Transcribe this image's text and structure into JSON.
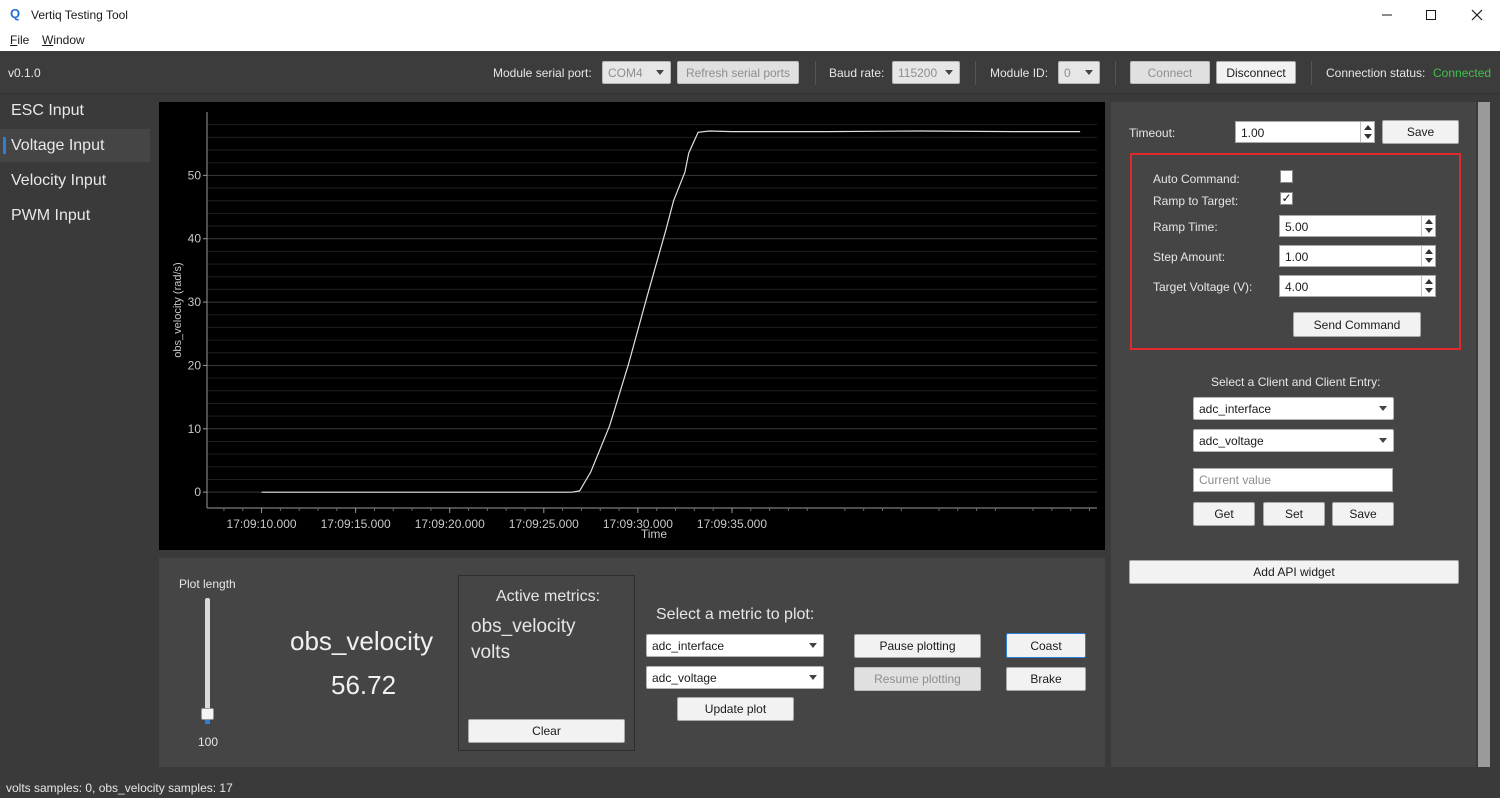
{
  "window": {
    "title": "Vertiq Testing Tool",
    "logo_letter": "Q",
    "menu": [
      "File",
      "Window"
    ],
    "menu_mnemonic_first": [
      "F",
      "W"
    ],
    "menu_rest": [
      "ile",
      "indow"
    ]
  },
  "toolbar": {
    "version": "v0.1.0",
    "serial_port_label": "Module serial port:",
    "serial_port_value": "COM4",
    "refresh_label": "Refresh serial ports",
    "baud_label": "Baud rate:",
    "baud_value": "115200",
    "module_id_label": "Module ID:",
    "module_id_value": "0",
    "connect_label": "Connect",
    "disconnect_label": "Disconnect",
    "conn_status_label": "Connection status:",
    "conn_status_value": "Connected",
    "conn_status_color": "#3fc24a"
  },
  "sidebar": {
    "items": [
      {
        "label": "ESC Input",
        "active": false
      },
      {
        "label": "Voltage Input",
        "active": true
      },
      {
        "label": "Velocity Input",
        "active": false
      },
      {
        "label": "PWM Input",
        "active": false
      }
    ]
  },
  "chart_data": {
    "type": "line",
    "xlabel": "Time",
    "ylabel": "obs_velocity (rad/s)",
    "x_ticks": [
      "17:09:10.000",
      "17:09:15.000",
      "17:09:20.000",
      "17:09:25.000",
      "17:09:30.000",
      "17:09:35.000"
    ],
    "y_ticks": [
      0,
      10,
      20,
      30,
      40,
      50
    ],
    "ylim": [
      -2.5,
      60
    ],
    "xlim_seconds": [
      -2.9,
      44.4
    ],
    "grid": true,
    "series": [
      {
        "x_seconds": [
          0,
          16.5,
          16.9,
          17.5,
          18.5,
          19.5,
          20.5,
          21.5,
          21.9,
          22.5,
          22.7,
          23.2,
          23.8,
          25,
          30,
          35,
          40,
          43.5
        ],
        "values": [
          0.0,
          0.0,
          0.2,
          3.2,
          10.5,
          20.2,
          31.0,
          41.5,
          46.0,
          50.5,
          53.5,
          56.8,
          57.0,
          56.9,
          56.9,
          57.0,
          56.9,
          56.9
        ],
        "color": "#e0e0e0"
      }
    ]
  },
  "plot_controls": {
    "plot_length_label": "Plot length",
    "plot_length_value": "100",
    "metric_name": "obs_velocity",
    "metric_value": "56.72",
    "active_metrics_title": "Active metrics:",
    "active_metrics": [
      "obs_velocity",
      "volts"
    ],
    "clear_label": "Clear",
    "select_metric_label": "Select a metric to plot:",
    "client_value": "adc_interface",
    "entry_value": "adc_voltage",
    "update_plot_label": "Update plot",
    "pause_label": "Pause plotting",
    "resume_label": "Resume plotting",
    "coast_label": "Coast",
    "brake_label": "Brake"
  },
  "right_panel": {
    "timeout_label": "Timeout:",
    "timeout_value": "1.00",
    "save_label": "Save",
    "auto_command_label": "Auto Command:",
    "auto_command_checked": false,
    "ramp_label": "Ramp to Target:",
    "ramp_checked": true,
    "ramp_time_label": "Ramp Time:",
    "ramp_time_value": "5.00",
    "step_label": "Step Amount:",
    "step_value": "1.00",
    "target_label": "Target Voltage (V):",
    "target_value": "4.00",
    "send_label": "Send Command",
    "highlight_color": "#e0282d",
    "select_client_label": "Select a Client and Client Entry:",
    "client_value": "adc_interface",
    "entry_value": "adc_voltage",
    "current_value_placeholder": "Current value",
    "get_label": "Get",
    "set_label": "Set",
    "save2_label": "Save",
    "add_widget_label": "Add API widget"
  },
  "status": {
    "text": "volts samples: 0, obs_velocity samples: 17"
  }
}
